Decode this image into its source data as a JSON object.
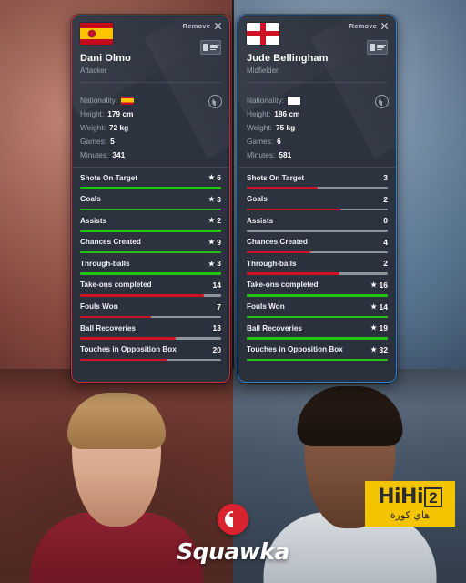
{
  "watermarks": {
    "squawka": "Squawka",
    "hihi_prefix": "HiHi",
    "hihi_box": "2",
    "hihi_arabic": "هاي كورة"
  },
  "common": {
    "remove_label": "Remove",
    "nationality_label": "Nationality:",
    "height_label": "Height:",
    "weight_label": "Weight:",
    "games_label": "Games:",
    "minutes_label": "Minutes:",
    "star_glyph": "★",
    "colors": {
      "win_bar": "#23c412",
      "lose_bar": "#cf1126",
      "track": "#8d949c",
      "card_bg": "#2e3440",
      "left_border": "#c8313d",
      "right_border": "#2f7fd0",
      "hihi_yellow": "#f5c400",
      "squawka_red": "#d9232e"
    }
  },
  "players": [
    {
      "name": "Dani Olmo",
      "position": "Attacker",
      "country": "Spain",
      "flag": "flag-es",
      "height": "179 cm",
      "weight": "72 kg",
      "games": "5",
      "minutes": "341",
      "stats": [
        {
          "label": "Shots On Target",
          "value": "6",
          "winner": true,
          "pct": 100
        },
        {
          "label": "Goals",
          "value": "3",
          "winner": true,
          "pct": 100
        },
        {
          "label": "Assists",
          "value": "2",
          "winner": true,
          "pct": 100
        },
        {
          "label": "Chances Created",
          "value": "9",
          "winner": true,
          "pct": 100
        },
        {
          "label": "Through-balls",
          "value": "3",
          "winner": true,
          "pct": 100
        },
        {
          "label": "Take-ons completed",
          "value": "14",
          "winner": false,
          "pct": 88
        },
        {
          "label": "Fouls Won",
          "value": "7",
          "winner": false,
          "pct": 50
        },
        {
          "label": "Ball Recoveries",
          "value": "13",
          "winner": false,
          "pct": 68
        },
        {
          "label": "Touches in Opposition Box",
          "value": "20",
          "winner": false,
          "pct": 62
        }
      ]
    },
    {
      "name": "Jude Bellingham",
      "position": "Midfielder",
      "country": "England",
      "flag": "flag-en",
      "height": "186 cm",
      "weight": "75 kg",
      "games": "6",
      "minutes": "581",
      "stats": [
        {
          "label": "Shots On Target",
          "value": "3",
          "winner": false,
          "pct": 50
        },
        {
          "label": "Goals",
          "value": "2",
          "winner": false,
          "pct": 67
        },
        {
          "label": "Assists",
          "value": "0",
          "winner": false,
          "pct": 0
        },
        {
          "label": "Chances Created",
          "value": "4",
          "winner": false,
          "pct": 45
        },
        {
          "label": "Through-balls",
          "value": "2",
          "winner": false,
          "pct": 66
        },
        {
          "label": "Take-ons completed",
          "value": "16",
          "winner": true,
          "pct": 100
        },
        {
          "label": "Fouls Won",
          "value": "14",
          "winner": true,
          "pct": 100
        },
        {
          "label": "Ball Recoveries",
          "value": "19",
          "winner": true,
          "pct": 100
        },
        {
          "label": "Touches in Opposition Box",
          "value": "32",
          "winner": true,
          "pct": 100
        }
      ]
    }
  ]
}
